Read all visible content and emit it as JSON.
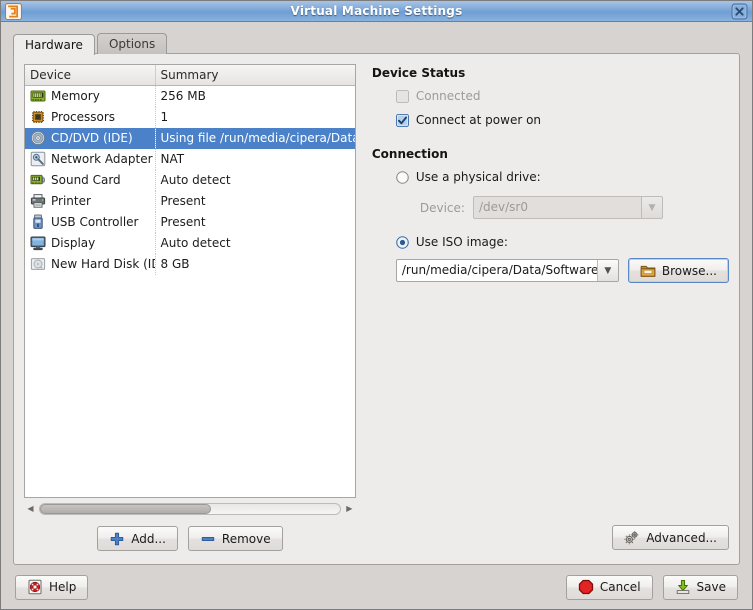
{
  "window": {
    "title": "Virtual Machine Settings",
    "app_icon": "vmware-logo-icon",
    "close_icon": "close-icon"
  },
  "tabs": [
    {
      "label": "Hardware",
      "active": true
    },
    {
      "label": "Options",
      "active": false
    }
  ],
  "device_list": {
    "columns": [
      "Device",
      "Summary"
    ],
    "rows": [
      {
        "icon": "memory-icon",
        "device": "Memory",
        "summary": "256 MB",
        "selected": false
      },
      {
        "icon": "processor-icon",
        "device": "Processors",
        "summary": "1",
        "selected": false
      },
      {
        "icon": "cd-dvd-icon",
        "device": "CD/DVD (IDE)",
        "summary": "Using file /run/media/cipera/Data/Softw",
        "selected": true
      },
      {
        "icon": "network-icon",
        "device": "Network Adapter",
        "summary": "NAT",
        "selected": false
      },
      {
        "icon": "sound-card-icon",
        "device": "Sound Card",
        "summary": "Auto detect",
        "selected": false
      },
      {
        "icon": "printer-icon",
        "device": "Printer",
        "summary": "Present",
        "selected": false
      },
      {
        "icon": "usb-icon",
        "device": "USB Controller",
        "summary": "Present",
        "selected": false
      },
      {
        "icon": "display-icon",
        "device": "Display",
        "summary": "Auto detect",
        "selected": false
      },
      {
        "icon": "hard-disk-icon",
        "device": "New Hard Disk (IDE)",
        "summary": "8 GB",
        "selected": false
      }
    ]
  },
  "list_buttons": {
    "add_label": "Add...",
    "add_icon": "plus-icon",
    "remove_label": "Remove",
    "remove_icon": "minus-icon"
  },
  "device_status": {
    "title": "Device Status",
    "connected_label": "Connected",
    "connected_checked": false,
    "connected_disabled": true,
    "connect_at_power_on_label": "Connect at power on",
    "connect_at_power_on_checked": true
  },
  "connection": {
    "title": "Connection",
    "physical_drive_label": "Use a physical drive:",
    "physical_drive_selected": false,
    "device_label": "Device:",
    "device_value": "/dev/sr0",
    "device_disabled": true,
    "iso_label": "Use ISO image:",
    "iso_selected": true,
    "iso_value": "/run/media/cipera/Data/Software/ISO/M",
    "browse_label": "Browse...",
    "browse_icon": "folder-open-icon"
  },
  "advanced": {
    "label": "Advanced...",
    "icon": "gears-icon"
  },
  "footer": {
    "help_label": "Help",
    "help_icon": "lifebuoy-icon",
    "cancel_label": "Cancel",
    "cancel_icon": "stop-octagon-icon",
    "save_label": "Save",
    "save_icon": "save-arrow-icon"
  },
  "colors": {
    "titlebar_blue": "#7ca6d8",
    "selection_blue": "#4a81c8",
    "panel_bg": "#eeecea",
    "window_bg": "#d6d3d0",
    "cancel_red": "#d51818",
    "save_green": "#7cc113",
    "accent_focus": "#5b87c4"
  }
}
